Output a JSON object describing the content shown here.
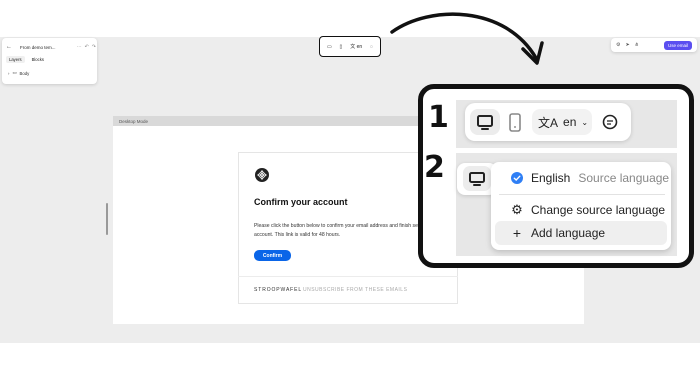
{
  "left_panel": {
    "title": "From demo tem...",
    "tabs": [
      "Layers",
      "Blocks"
    ],
    "tree_item": "Body"
  },
  "top_toolbar": {
    "lang": "en"
  },
  "right_toolbar": {
    "use_email": "Use email"
  },
  "canvas": {
    "mode_label": "Desktop Mode"
  },
  "email": {
    "heading": "Confirm your account",
    "body": "Please click the button below to confirm your email address and finish setting up your account. This link is valid for 48 hours.",
    "button": "Confirm",
    "footer_brand": "STROOPWAFEL",
    "footer_unsubscribe": "UNSUBSCRIBE FROM THESE EMAILS"
  },
  "callout": {
    "step1": "1",
    "step2": "2",
    "lang": "en",
    "menu": {
      "english": "English",
      "source": "Source language",
      "change": "Change source language",
      "add": "Add language"
    }
  },
  "colors": {
    "accent": "#5b4ff0",
    "confirm": "#0a65e8",
    "check": "#2f7ff5"
  }
}
